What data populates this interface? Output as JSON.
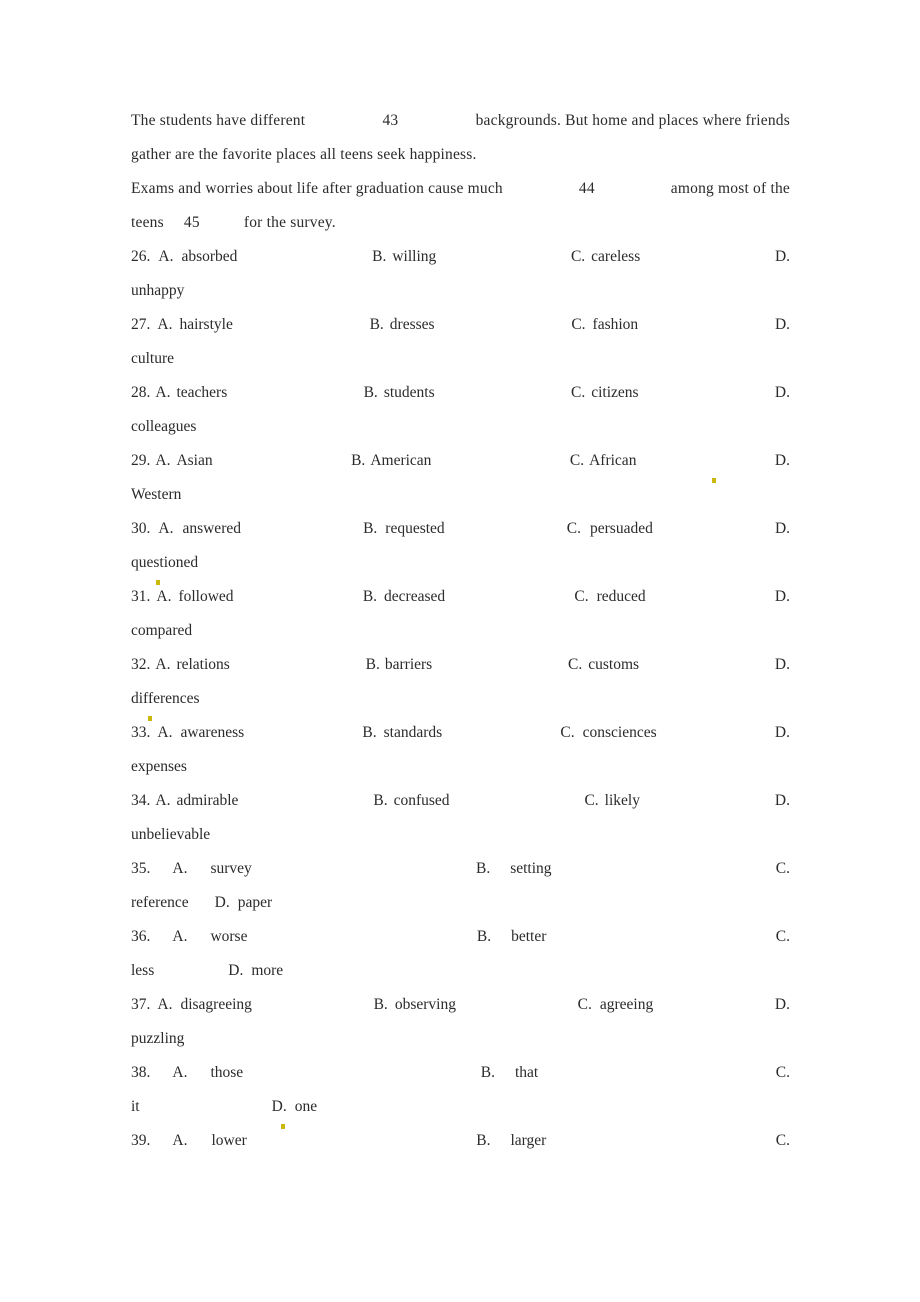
{
  "document": {
    "type": "scanned-exam-page",
    "language": "en",
    "page_background": "#ffffff",
    "text_color": "#2b2b2b"
  },
  "passage": {
    "lines": [
      {
        "id": "passage-line-1",
        "segments": [
          "The students have different",
          "43",
          "backgrounds. But home and places where friends"
        ],
        "justified": true
      },
      {
        "id": "passage-line-2",
        "segments": [
          "gather are the favorite places all teens seek happiness."
        ],
        "justified": false
      },
      {
        "id": "passage-line-3",
        "segments": [
          "Exams and worries about life after graduation cause much",
          "44",
          "among most of the"
        ],
        "justified": true
      },
      {
        "id": "passage-line-4",
        "segments": [
          "teens",
          "45",
          "for the survey."
        ],
        "justified": false
      }
    ],
    "blanks": [
      "43",
      "44",
      "45"
    ]
  },
  "questions": [
    {
      "number": "26.",
      "a_label": "A.",
      "a_text": "absorbed",
      "b_label": "B.",
      "b_text": "willing",
      "c_label": "C.",
      "c_text": "careless",
      "d_label": "D.",
      "d_text": "unhappy",
      "wrap_style": "d-text-next-line"
    },
    {
      "number": "27.",
      "a_label": "A.",
      "a_text": "hairstyle",
      "b_label": "B.",
      "b_text": "dresses",
      "c_label": "C.",
      "c_text": "fashion",
      "d_label": "D.",
      "d_text": "culture",
      "wrap_style": "d-text-next-line"
    },
    {
      "number": "28.",
      "a_label": "A.",
      "a_text": "teachers",
      "b_label": "B.",
      "b_text": "students",
      "c_label": "C.",
      "c_text": "citizens",
      "d_label": "D.",
      "d_text": "colleagues",
      "wrap_style": "d-text-next-line"
    },
    {
      "number": "29.",
      "a_label": "A.",
      "a_text": "Asian",
      "b_label": "B.",
      "b_text": "American",
      "c_label": "C.",
      "c_text": "African",
      "d_label": "D.",
      "d_text": "Western",
      "wrap_style": "d-text-next-line"
    },
    {
      "number": "30.",
      "a_label": "A.",
      "a_text": "answered",
      "b_label": "B.",
      "b_text": "requested",
      "c_label": "C.",
      "c_text": "persuaded",
      "d_label": "D.",
      "d_text": "questioned",
      "wrap_style": "d-text-next-line"
    },
    {
      "number": "31.",
      "a_label": "A.",
      "a_text": "followed",
      "b_label": "B.",
      "b_text": "decreased",
      "c_label": "C.",
      "c_text": "reduced",
      "d_label": "D.",
      "d_text": "compared",
      "wrap_style": "d-text-next-line"
    },
    {
      "number": "32.",
      "a_label": "A.",
      "a_text": "relations",
      "b_label": "B.",
      "b_text": "barriers",
      "c_label": "C.",
      "c_text": "customs",
      "d_label": "D.",
      "d_text": "differences",
      "wrap_style": "d-text-next-line"
    },
    {
      "number": "33.",
      "a_label": "A.",
      "a_text": "awareness",
      "b_label": "B.",
      "b_text": "standards",
      "c_label": "C.",
      "c_text": "consciences",
      "d_label": "D.",
      "d_text": "expenses",
      "wrap_style": "d-text-next-line"
    },
    {
      "number": "34.",
      "a_label": "A.",
      "a_text": "admirable",
      "b_label": "B.",
      "b_text": "confused",
      "c_label": "C.",
      "c_text": "likely",
      "d_label": "D.",
      "d_text": "unbelievable",
      "wrap_style": "d-text-next-line"
    },
    {
      "number": "35.",
      "a_label": "A.",
      "a_text": "survey",
      "b_label": "B.",
      "b_text": "setting",
      "c_label": "C.",
      "c_text": "reference",
      "d_label": "D.",
      "d_text": "paper",
      "wrap_style": "c-text-and-d-next-line"
    },
    {
      "number": "36.",
      "a_label": "A.",
      "a_text": "worse",
      "b_label": "B.",
      "b_text": "better",
      "c_label": "C.",
      "c_text": "less",
      "d_label": "D.",
      "d_text": "more",
      "wrap_style": "c-text-and-d-next-line"
    },
    {
      "number": "37.",
      "a_label": "A.",
      "a_text": "disagreeing",
      "b_label": "B.",
      "b_text": "observing",
      "c_label": "C.",
      "c_text": "agreeing",
      "d_label": "D.",
      "d_text": "puzzling",
      "wrap_style": "d-text-next-line"
    },
    {
      "number": "38.",
      "a_label": "A.",
      "a_text": "those",
      "b_label": "B.",
      "b_text": "that",
      "c_label": "C.",
      "c_text": "it",
      "d_label": "D.",
      "d_text": "one",
      "wrap_style": "c-text-and-d-next-line"
    },
    {
      "number": "39.",
      "a_label": "A.",
      "a_text": "lower",
      "b_label": "B.",
      "b_text": "larger",
      "c_label": "C.",
      "c_text": "",
      "d_label": "",
      "d_text": "",
      "wrap_style": "truncated-at-page-bottom"
    }
  ]
}
